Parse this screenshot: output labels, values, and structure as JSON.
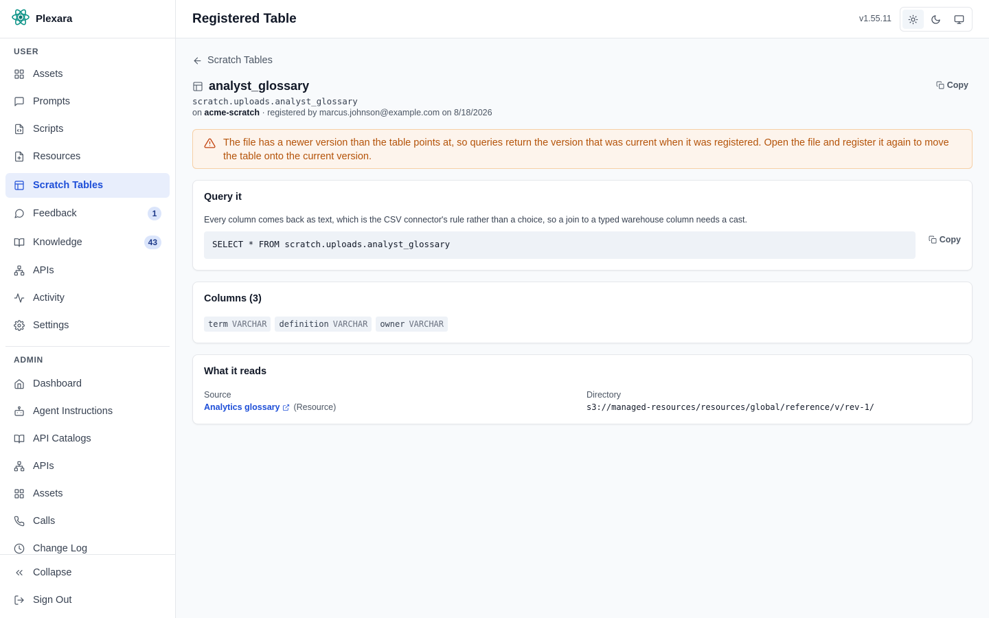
{
  "app": {
    "name": "Plexara",
    "version": "v1.55.11"
  },
  "header": {
    "title": "Registered Table"
  },
  "sidebar": {
    "user_label": "USER",
    "admin_label": "ADMIN",
    "user_items": [
      {
        "label": "Assets",
        "icon": "grid-icon"
      },
      {
        "label": "Prompts",
        "icon": "message-square-icon"
      },
      {
        "label": "Scripts",
        "icon": "file-code-icon"
      },
      {
        "label": "Resources",
        "icon": "file-plus-icon"
      },
      {
        "label": "Scratch Tables",
        "icon": "table-icon",
        "active": true
      },
      {
        "label": "Feedback",
        "icon": "message-circle-icon",
        "badge": "1"
      },
      {
        "label": "Knowledge",
        "icon": "book-open-icon",
        "badge": "43"
      },
      {
        "label": "APIs",
        "icon": "network-icon"
      },
      {
        "label": "Activity",
        "icon": "activity-icon"
      },
      {
        "label": "Settings",
        "icon": "gear-icon"
      }
    ],
    "admin_items": [
      {
        "label": "Dashboard",
        "icon": "home-icon"
      },
      {
        "label": "Agent Instructions",
        "icon": "bot-icon"
      },
      {
        "label": "API Catalogs",
        "icon": "book-open-icon"
      },
      {
        "label": "APIs",
        "icon": "network-icon"
      },
      {
        "label": "Assets",
        "icon": "grid-icon"
      },
      {
        "label": "Calls",
        "icon": "phone-icon"
      },
      {
        "label": "Change Log",
        "icon": "clock-icon"
      }
    ],
    "footer": {
      "collapse": "Collapse",
      "sign_out": "Sign Out"
    }
  },
  "main": {
    "back_label": "Scratch Tables",
    "table": {
      "name": "analyst_glossary",
      "qualified_name": "scratch.uploads.analyst_glossary",
      "meta_prefix": "on",
      "catalog": "acme-scratch",
      "meta_suffix": "· registered by marcus.johnson@example.com on 8/18/2026"
    },
    "copy_label": "Copy",
    "alert": "The file has a newer version than the table points at, so queries return the version that was current when it was registered. Open the file and register it again to move the table onto the current version.",
    "query": {
      "title": "Query it",
      "description": "Every column comes back as text, which is the CSV connector's rule rather than a choice, so a join to a typed warehouse column needs a cast.",
      "sql": "SELECT * FROM scratch.uploads.analyst_glossary",
      "copy_label": "Copy"
    },
    "columns": {
      "title": "Columns (3)",
      "items": [
        {
          "name": "term",
          "type": "VARCHAR"
        },
        {
          "name": "definition",
          "type": "VARCHAR"
        },
        {
          "name": "owner",
          "type": "VARCHAR"
        }
      ]
    },
    "reads": {
      "title": "What it reads",
      "source_label": "Source",
      "source_link": "Analytics glossary",
      "source_kind": "(Resource)",
      "directory_label": "Directory",
      "directory": "s3://managed-resources/resources/global/reference/v/rev-1/"
    }
  },
  "colors": {
    "accent": "#1d4ed8",
    "active_bg": "#e8eefc",
    "warning_bg": "#fdf4ec",
    "warning_text": "#b45309"
  }
}
